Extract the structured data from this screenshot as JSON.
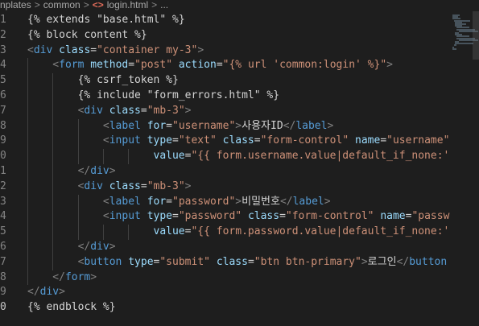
{
  "breadcrumb": {
    "items": [
      "nplates",
      "common",
      "login.html",
      "..."
    ],
    "separators": [
      ">",
      ">",
      ">"
    ]
  },
  "editor": {
    "lines": [
      {
        "num": "1",
        "tokens": [
          {
            "t": "tpl",
            "v": "{% extends \"base.html\" %}"
          }
        ]
      },
      {
        "num": "2",
        "tokens": [
          {
            "t": "tpl",
            "v": "{% block content %}"
          }
        ]
      },
      {
        "num": "3",
        "tokens": [
          {
            "t": "br",
            "v": "<"
          },
          {
            "t": "tag",
            "v": "div"
          },
          {
            "t": "text",
            "v": " "
          },
          {
            "t": "attr",
            "v": "class"
          },
          {
            "t": "text",
            "v": "="
          },
          {
            "t": "str",
            "v": "\"container my-3\""
          },
          {
            "t": "br",
            "v": ">"
          }
        ]
      },
      {
        "num": "4",
        "indent": 1,
        "tokens": [
          {
            "t": "br",
            "v": "<"
          },
          {
            "t": "tag",
            "v": "form"
          },
          {
            "t": "text",
            "v": " "
          },
          {
            "t": "attr",
            "v": "method"
          },
          {
            "t": "text",
            "v": "="
          },
          {
            "t": "str",
            "v": "\"post\""
          },
          {
            "t": "text",
            "v": " "
          },
          {
            "t": "attr",
            "v": "action"
          },
          {
            "t": "text",
            "v": "="
          },
          {
            "t": "str",
            "v": "\"{% url 'common:login' %}\""
          },
          {
            "t": "br",
            "v": ">"
          }
        ]
      },
      {
        "num": "5",
        "indent": 2,
        "tokens": [
          {
            "t": "tpl",
            "v": "{% csrf_token %}"
          }
        ]
      },
      {
        "num": "6",
        "indent": 2,
        "tokens": [
          {
            "t": "tpl",
            "v": "{% include \"form_errors.html\" %}"
          }
        ]
      },
      {
        "num": "7",
        "indent": 2,
        "tokens": [
          {
            "t": "br",
            "v": "<"
          },
          {
            "t": "tag",
            "v": "div"
          },
          {
            "t": "text",
            "v": " "
          },
          {
            "t": "attr",
            "v": "class"
          },
          {
            "t": "text",
            "v": "="
          },
          {
            "t": "str",
            "v": "\"mb-3\""
          },
          {
            "t": "br",
            "v": ">"
          }
        ]
      },
      {
        "num": "8",
        "indent": 3,
        "tokens": [
          {
            "t": "br",
            "v": "<"
          },
          {
            "t": "tag",
            "v": "label"
          },
          {
            "t": "text",
            "v": " "
          },
          {
            "t": "attr",
            "v": "for"
          },
          {
            "t": "text",
            "v": "="
          },
          {
            "t": "str",
            "v": "\"username\""
          },
          {
            "t": "br",
            "v": ">"
          },
          {
            "t": "text",
            "v": "사용자ID"
          },
          {
            "t": "br",
            "v": "</"
          },
          {
            "t": "tag",
            "v": "label"
          },
          {
            "t": "br",
            "v": ">"
          }
        ]
      },
      {
        "num": "9",
        "indent": 3,
        "tokens": [
          {
            "t": "br",
            "v": "<"
          },
          {
            "t": "tag",
            "v": "input"
          },
          {
            "t": "text",
            "v": " "
          },
          {
            "t": "attr",
            "v": "type"
          },
          {
            "t": "text",
            "v": "="
          },
          {
            "t": "str",
            "v": "\"text\""
          },
          {
            "t": "text",
            "v": " "
          },
          {
            "t": "attr",
            "v": "class"
          },
          {
            "t": "text",
            "v": "="
          },
          {
            "t": "str",
            "v": "\"form-control\""
          },
          {
            "t": "text",
            "v": " "
          },
          {
            "t": "attr",
            "v": "name"
          },
          {
            "t": "text",
            "v": "="
          },
          {
            "t": "str",
            "v": "\"username\""
          }
        ]
      },
      {
        "num": "0",
        "indent": 5,
        "tokens": [
          {
            "t": "attr",
            "v": "value"
          },
          {
            "t": "text",
            "v": "="
          },
          {
            "t": "str",
            "v": "\"{{ form.username.value|default_if_none:''"
          }
        ]
      },
      {
        "num": "1",
        "indent": 2,
        "tokens": [
          {
            "t": "br",
            "v": "</"
          },
          {
            "t": "tag",
            "v": "div"
          },
          {
            "t": "br",
            "v": ">"
          }
        ]
      },
      {
        "num": "2",
        "indent": 2,
        "tokens": [
          {
            "t": "br",
            "v": "<"
          },
          {
            "t": "tag",
            "v": "div"
          },
          {
            "t": "text",
            "v": " "
          },
          {
            "t": "attr",
            "v": "class"
          },
          {
            "t": "text",
            "v": "="
          },
          {
            "t": "str",
            "v": "\"mb-3\""
          },
          {
            "t": "br",
            "v": ">"
          }
        ]
      },
      {
        "num": "3",
        "indent": 3,
        "tokens": [
          {
            "t": "br",
            "v": "<"
          },
          {
            "t": "tag",
            "v": "label"
          },
          {
            "t": "text",
            "v": " "
          },
          {
            "t": "attr",
            "v": "for"
          },
          {
            "t": "text",
            "v": "="
          },
          {
            "t": "str",
            "v": "\"password\""
          },
          {
            "t": "br",
            "v": ">"
          },
          {
            "t": "text",
            "v": "비밀번호"
          },
          {
            "t": "br",
            "v": "</"
          },
          {
            "t": "tag",
            "v": "label"
          },
          {
            "t": "br",
            "v": ">"
          }
        ]
      },
      {
        "num": "4",
        "indent": 3,
        "tokens": [
          {
            "t": "br",
            "v": "<"
          },
          {
            "t": "tag",
            "v": "input"
          },
          {
            "t": "text",
            "v": " "
          },
          {
            "t": "attr",
            "v": "type"
          },
          {
            "t": "text",
            "v": "="
          },
          {
            "t": "str",
            "v": "\"password\""
          },
          {
            "t": "text",
            "v": " "
          },
          {
            "t": "attr",
            "v": "class"
          },
          {
            "t": "text",
            "v": "="
          },
          {
            "t": "str",
            "v": "\"form-control\""
          },
          {
            "t": "text",
            "v": " "
          },
          {
            "t": "attr",
            "v": "name"
          },
          {
            "t": "text",
            "v": "="
          },
          {
            "t": "str",
            "v": "\"passw"
          }
        ]
      },
      {
        "num": "5",
        "indent": 5,
        "tokens": [
          {
            "t": "attr",
            "v": "value"
          },
          {
            "t": "text",
            "v": "="
          },
          {
            "t": "str",
            "v": "\"{{ form.password.value|default_if_none:''"
          }
        ]
      },
      {
        "num": "6",
        "indent": 2,
        "tokens": [
          {
            "t": "br",
            "v": "</"
          },
          {
            "t": "tag",
            "v": "div"
          },
          {
            "t": "br",
            "v": ">"
          }
        ]
      },
      {
        "num": "7",
        "indent": 2,
        "tokens": [
          {
            "t": "br",
            "v": "<"
          },
          {
            "t": "tag",
            "v": "button"
          },
          {
            "t": "text",
            "v": " "
          },
          {
            "t": "attr",
            "v": "type"
          },
          {
            "t": "text",
            "v": "="
          },
          {
            "t": "str",
            "v": "\"submit\""
          },
          {
            "t": "text",
            "v": " "
          },
          {
            "t": "attr",
            "v": "class"
          },
          {
            "t": "text",
            "v": "="
          },
          {
            "t": "str",
            "v": "\"btn btn-primary\""
          },
          {
            "t": "br",
            "v": ">"
          },
          {
            "t": "text",
            "v": "로그인"
          },
          {
            "t": "br",
            "v": "</"
          },
          {
            "t": "tag",
            "v": "button"
          }
        ]
      },
      {
        "num": "8",
        "indent": 1,
        "tokens": [
          {
            "t": "br",
            "v": "</"
          },
          {
            "t": "tag",
            "v": "form"
          },
          {
            "t": "br",
            "v": ">"
          }
        ]
      },
      {
        "num": "9",
        "tokens": [
          {
            "t": "br",
            "v": "</"
          },
          {
            "t": "tag",
            "v": "div"
          },
          {
            "t": "br",
            "v": ">"
          }
        ]
      },
      {
        "num": "0",
        "active": true,
        "tokens": [
          {
            "t": "tpl",
            "v": "{% endblock %}"
          }
        ]
      }
    ]
  },
  "colors": {
    "background": "#1e1e1e",
    "tag": "#569cd6",
    "attribute": "#9cdcfe",
    "string": "#ce9178",
    "text": "#d4d4d4",
    "line_number": "#858585",
    "file_icon": "#e06c5a"
  },
  "icons": {
    "file_icon": "html-file-icon",
    "separator_icon": "chevron-right-icon"
  }
}
